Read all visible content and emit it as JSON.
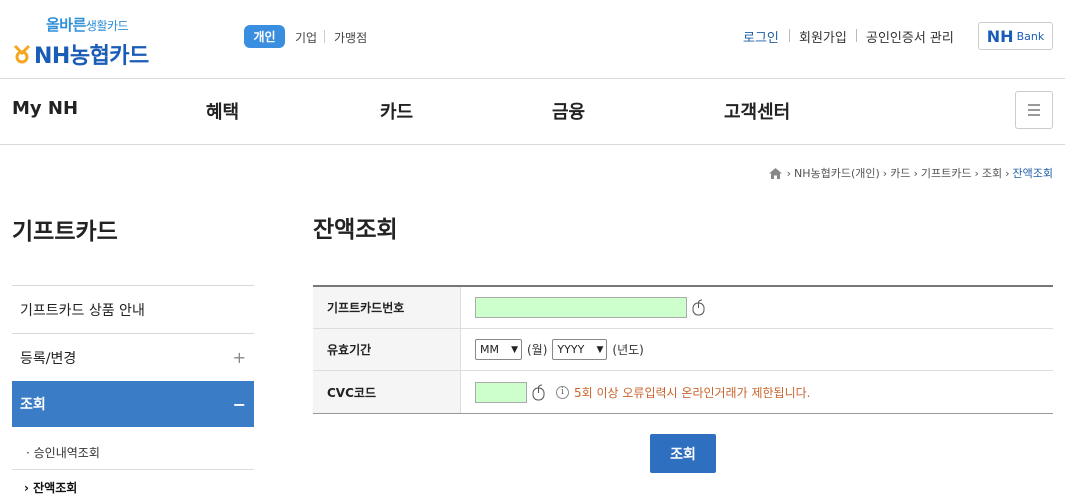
{
  "header": {
    "slogan": "올바른",
    "slogan_small": "생활카드",
    "logo_text": "NH농협카드",
    "segments": [
      "개인",
      "기업",
      "가맹점"
    ],
    "util": {
      "login": "로그인",
      "join": "회원가입",
      "cert": "공인인증서 관리"
    },
    "nhbank": {
      "nh": "NH",
      "bank": "Bank"
    }
  },
  "gnb": [
    "My NH",
    "혜택",
    "카드",
    "금융",
    "고객센터"
  ],
  "breadcrumb": [
    "NH농협카드(개인)",
    "카드",
    "기프트카드",
    "조회",
    "잔액조회"
  ],
  "sidebar": {
    "title": "기프트카드",
    "items": [
      {
        "label": "기프트카드 상품 안내",
        "mark": ""
      },
      {
        "label": "등록/변경",
        "mark": "+"
      },
      {
        "label": "조회",
        "mark": "−"
      }
    ],
    "sub_items": [
      "· 승인내역조회",
      "› 잔액조회"
    ]
  },
  "main": {
    "title": "잔액조회",
    "form": {
      "card_label": "기프트카드번호",
      "card_value": "",
      "expiry_label": "유효기간",
      "month_select": "MM",
      "month_unit": "(월)",
      "year_select": "YYYY",
      "year_unit": "(년도)",
      "cvc_label": "CVC코드",
      "cvc_value": "",
      "info_glyph": "i",
      "cvc_warning": "5회 이상 오류입력시 온라인거래가 제한됩니다."
    },
    "submit_label": "조회"
  },
  "colors": {
    "accent": "#3a7cc6",
    "button": "#2e6fc0",
    "input_bg": "#ccffcc",
    "warning": "#c8642c",
    "brand": "#1a5db6"
  }
}
